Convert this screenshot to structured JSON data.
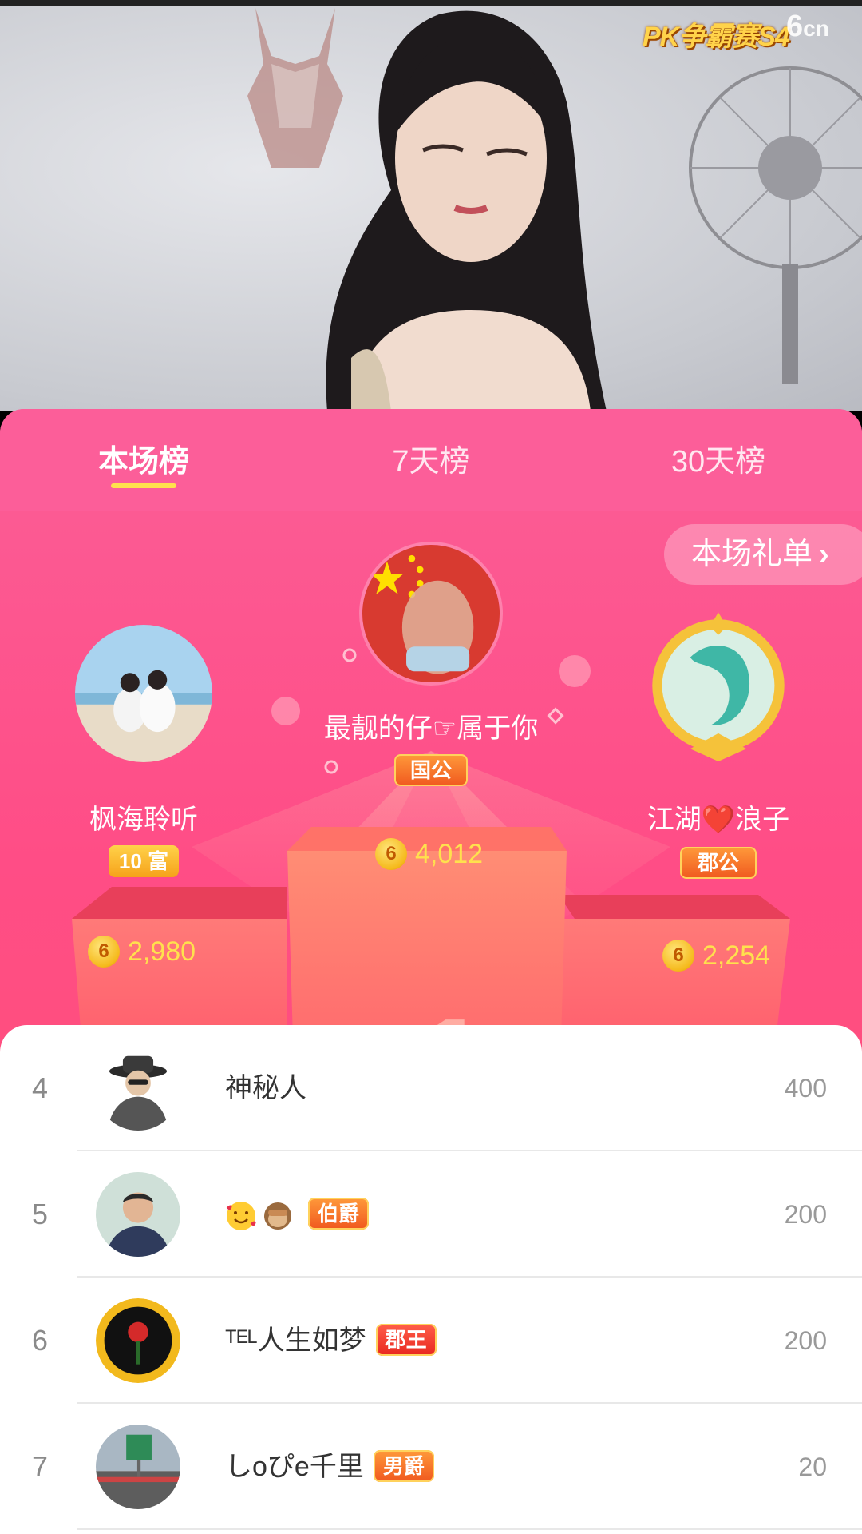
{
  "stream": {
    "event_badge": "PK争霸赛S4",
    "site_badge_main": "6",
    "site_badge_suffix": "cn"
  },
  "tabs": [
    {
      "label": "本场榜",
      "active": true
    },
    {
      "label": "7天榜",
      "active": false
    },
    {
      "label": "30天榜",
      "active": false
    }
  ],
  "gift_list_button": "本场礼单",
  "podium": {
    "first": {
      "name": "最靓的仔☞属于你",
      "title_badge": "国公",
      "score": "4,012"
    },
    "second": {
      "name": "枫海聆听",
      "title_badge": "10 富",
      "score": "2,980"
    },
    "third": {
      "name": "江湖❤️浪子",
      "title_badge": "郡公",
      "score": "2,254"
    }
  },
  "coin_symbol": "6",
  "ranking": [
    {
      "rank": "4",
      "name": "神秘人",
      "badge": "",
      "value": "400"
    },
    {
      "rank": "5",
      "name": "",
      "badge": "伯爵",
      "value": "200"
    },
    {
      "rank": "6",
      "name": "ᵀᴱᴸ人生如梦",
      "badge": "郡王",
      "value": "200"
    },
    {
      "rank": "7",
      "name": "しoぴe千里",
      "badge": "男爵",
      "value": "20"
    }
  ],
  "colors": {
    "panel_pink": "#fc5e99",
    "highlight_yellow": "#ffe14d",
    "tag_orange": "#f0581f"
  }
}
